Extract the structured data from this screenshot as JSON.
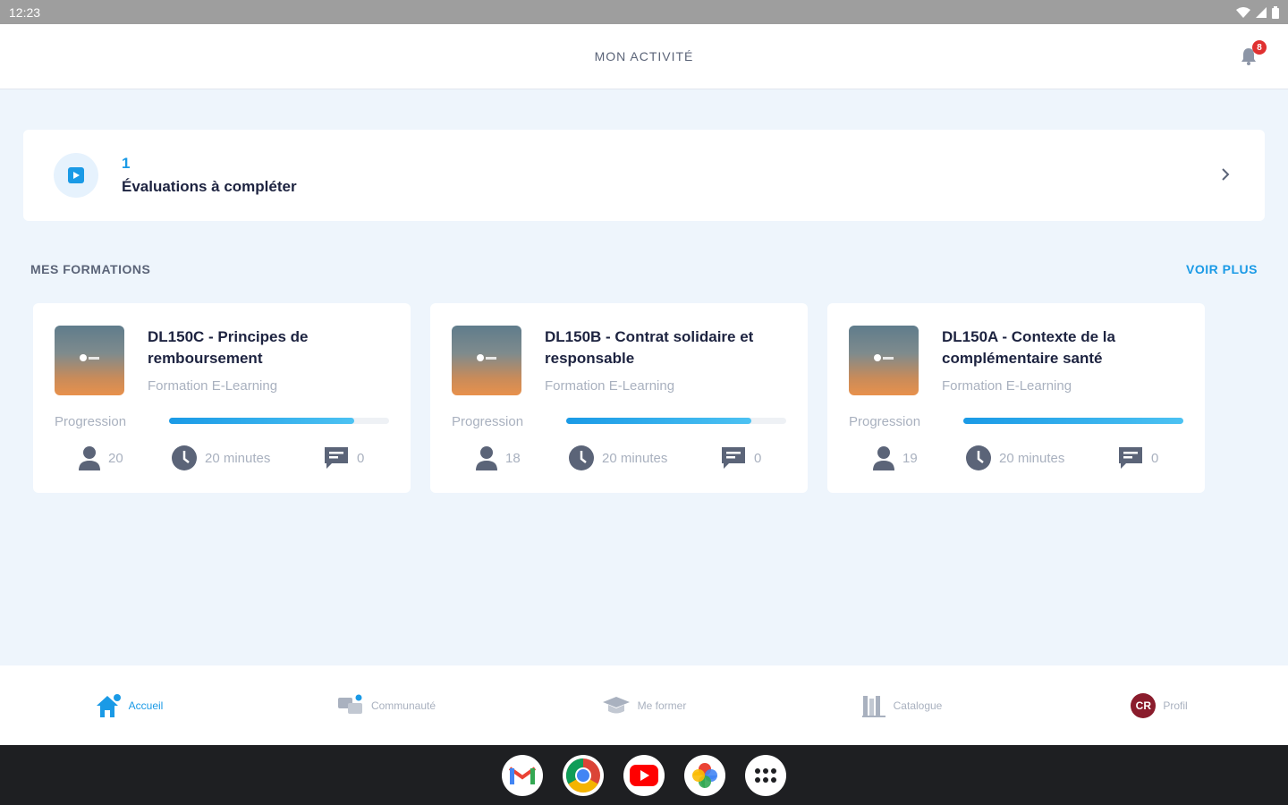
{
  "status_bar": {
    "time": "12:23"
  },
  "header": {
    "title": "MON ACTIVITÉ",
    "notification_count": "8"
  },
  "evaluations": {
    "count": "1",
    "label": "Évaluations à compléter"
  },
  "section": {
    "title": "MES FORMATIONS",
    "see_more": "VOIR PLUS"
  },
  "courses": [
    {
      "title": "DL150C - Principes de remboursement",
      "type": "Formation E-Learning",
      "progress_label": "Progression",
      "progress": 0.84,
      "learners": "20",
      "duration": "20 minutes",
      "comments": "0"
    },
    {
      "title": "DL150B - Contrat solidaire et responsable",
      "type": "Formation E-Learning",
      "progress_label": "Progression",
      "progress": 0.84,
      "learners": "18",
      "duration": "20 minutes",
      "comments": "0"
    },
    {
      "title": "DL150A - Contexte de la complémentaire santé",
      "type": "Formation E-Learning",
      "progress_label": "Progression",
      "progress": 1.0,
      "learners": "19",
      "duration": "20 minutes",
      "comments": "0"
    }
  ],
  "bottom_nav": [
    {
      "label": "Accueil",
      "icon": "home-icon",
      "active": true
    },
    {
      "label": "Communauté",
      "icon": "community-icon",
      "active": false
    },
    {
      "label": "Me former",
      "icon": "graduation-cap-icon",
      "active": false
    },
    {
      "label": "Catalogue",
      "icon": "books-icon",
      "active": false
    },
    {
      "label": "Profil",
      "icon": "avatar",
      "initials": "CR",
      "active": false
    }
  ],
  "dock": [
    "gmail-icon",
    "chrome-icon",
    "youtube-icon",
    "photos-icon",
    "apps-icon"
  ],
  "colors": {
    "accent": "#1a9ae6",
    "background": "#eef5fc",
    "text_dark": "#1d2340",
    "muted": "#a9b1bf",
    "avatar": "#8a1c2c"
  }
}
